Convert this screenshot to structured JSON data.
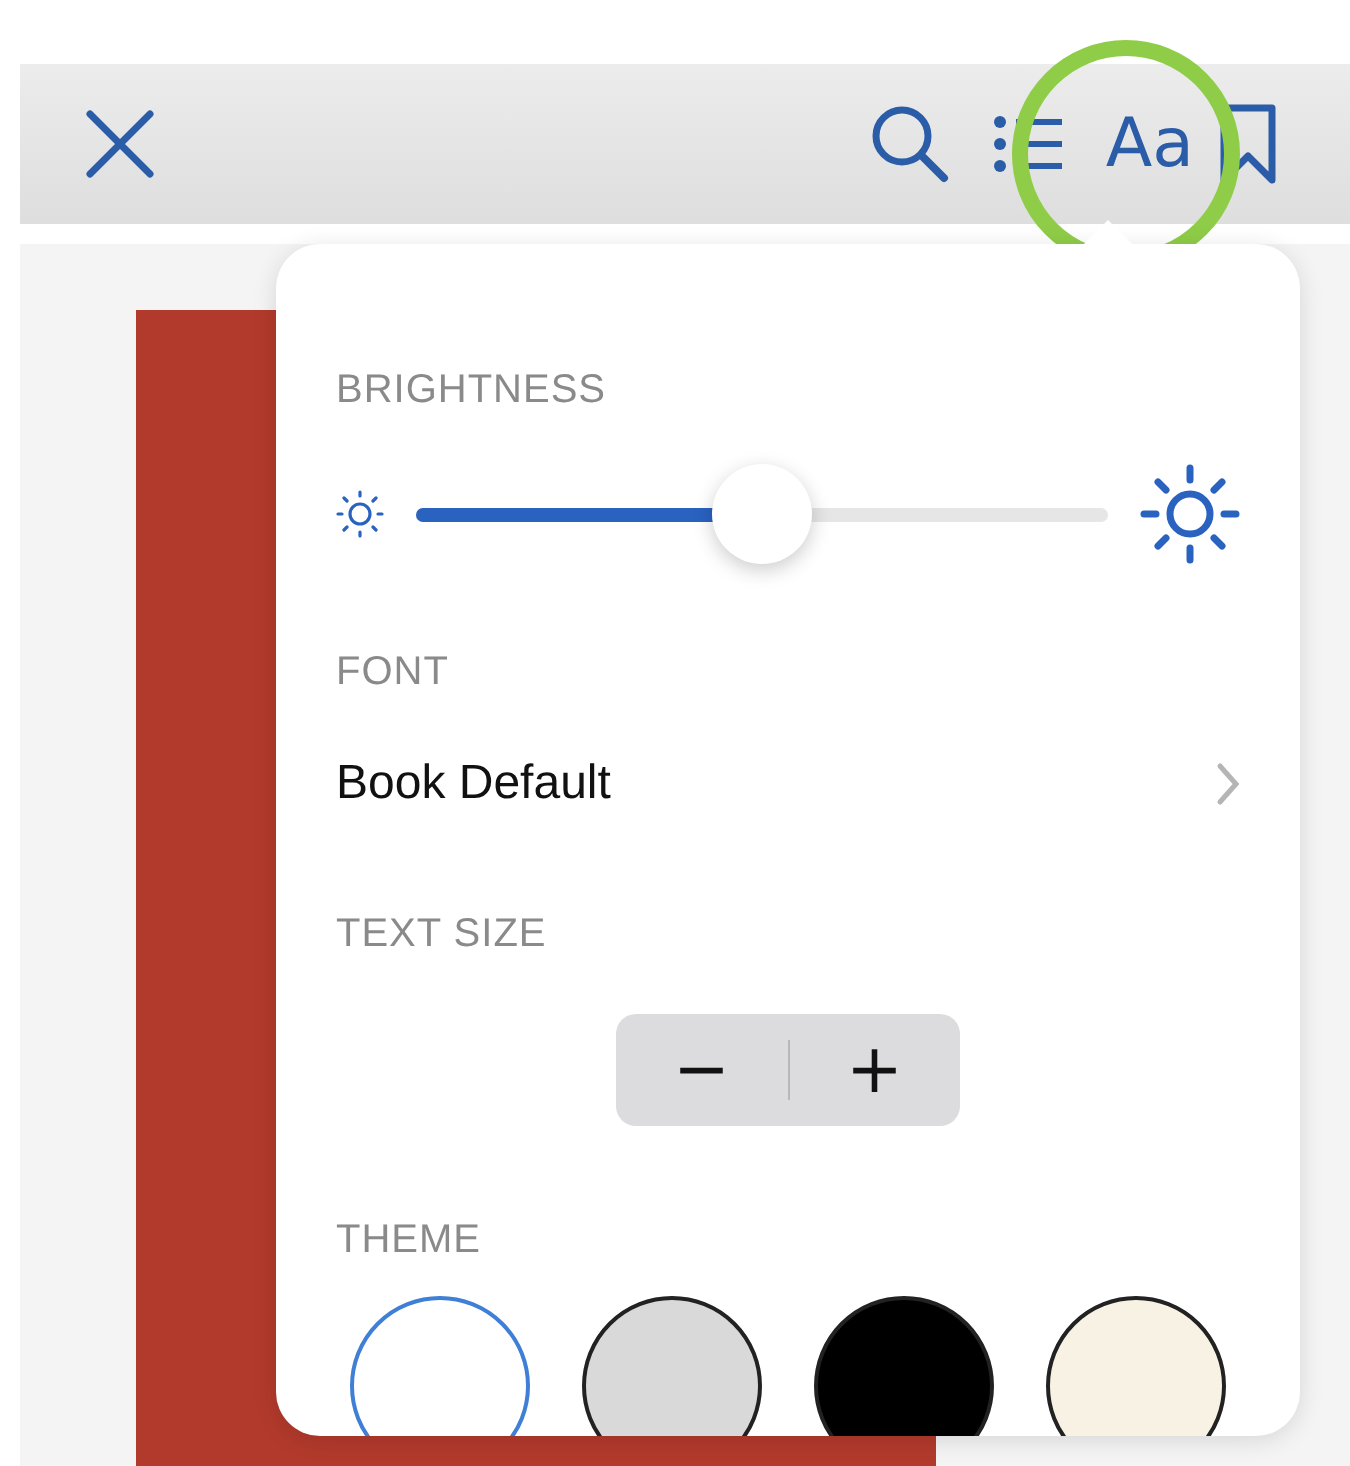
{
  "toolbar": {
    "font_button": "Aa",
    "font_button_highlighted": true
  },
  "brightness": {
    "label": "BRIGHTNESS",
    "level": 0.5
  },
  "font": {
    "label": "FONT",
    "value": "Book Default"
  },
  "text_size": {
    "label": "TEXT SIZE",
    "decrease": "−",
    "increase": "+"
  },
  "theme": {
    "label": "THEME",
    "options": [
      {
        "color": "#ffffff",
        "selected": true
      },
      {
        "color": "#d9d9d9",
        "selected": false
      },
      {
        "color": "#000000",
        "selected": false
      },
      {
        "color": "#f8f2e4",
        "selected": false
      }
    ]
  }
}
